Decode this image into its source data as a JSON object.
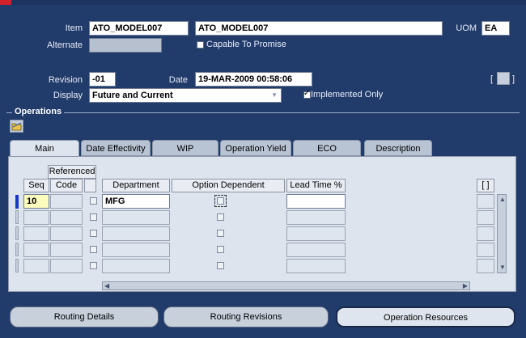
{
  "header": {
    "item_label": "Item",
    "item_value": "ATO_MODEL007",
    "item_description": "ATO_MODEL007",
    "uom_label": "UOM",
    "uom_value": "EA",
    "alternate_label": "Alternate",
    "alternate_value": "",
    "ctp_label": "Capable To Promise",
    "ctp_checked": false,
    "revision_label": "Revision",
    "revision_value": "-01",
    "date_label": "Date",
    "date_value": "19-MAR-2009 00:58:06",
    "display_label": "Display",
    "display_value": "Future and Current",
    "implemented_label": "Implemented Only",
    "implemented_checked": true,
    "bracket_open": "[",
    "bracket_close": "]"
  },
  "operations": {
    "title": "Operations",
    "tabs": [
      "Main",
      "Date Effectivity",
      "WIP",
      "Operation Yield",
      "ECO",
      "Description"
    ],
    "active_tab": "Main",
    "columns": {
      "referenced_group": "Referenced",
      "seq": "Seq",
      "code": "Code",
      "department": "Department",
      "option_dependent": "Option Dependent",
      "lead_time": "Lead Time %",
      "flex": "[ ]"
    },
    "rows": [
      {
        "seq": "10",
        "code": "",
        "department": "MFG",
        "option_dependent": false,
        "lead_time": ""
      },
      {
        "seq": "",
        "code": "",
        "department": "",
        "option_dependent": false,
        "lead_time": ""
      },
      {
        "seq": "",
        "code": "",
        "department": "",
        "option_dependent": false,
        "lead_time": ""
      },
      {
        "seq": "",
        "code": "",
        "department": "",
        "option_dependent": false,
        "lead_time": ""
      },
      {
        "seq": "",
        "code": "",
        "department": "",
        "option_dependent": false,
        "lead_time": ""
      }
    ]
  },
  "buttons": {
    "routing_details": "Routing Details",
    "routing_revisions": "Routing Revisions",
    "operation_resources": "Operation Resources"
  },
  "colors": {
    "background": "#213b6b",
    "panel": "#dde4ee",
    "current_field": "#fcfcbc"
  },
  "icons": {
    "toolbar": "folder-open-icon"
  }
}
